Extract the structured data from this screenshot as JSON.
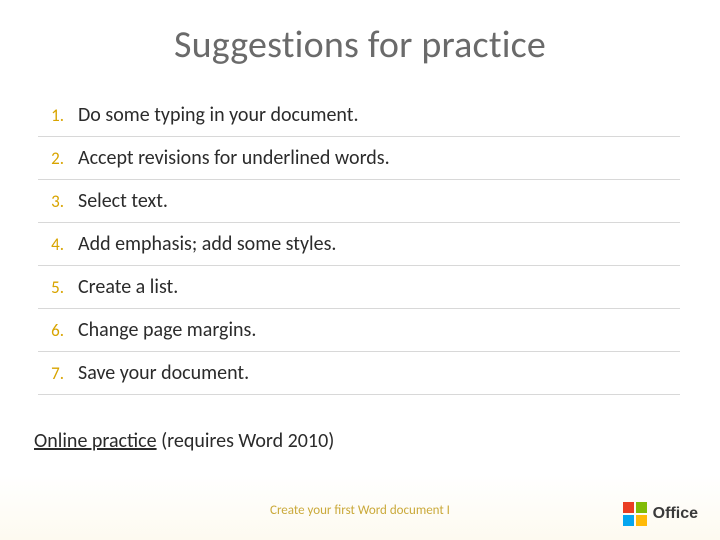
{
  "title": "Suggestions for practice",
  "items": [
    "Do some typing in your document.",
    "Accept revisions for underlined words.",
    "Select text.",
    "Add emphasis; add some styles.",
    "Create a list.",
    "Change page margins.",
    "Save your document."
  ],
  "link": {
    "label": "Online practice",
    "suffix": " (requires Word 2010)"
  },
  "footer": "Create your first Word document I",
  "logo": {
    "brand": "Office"
  }
}
